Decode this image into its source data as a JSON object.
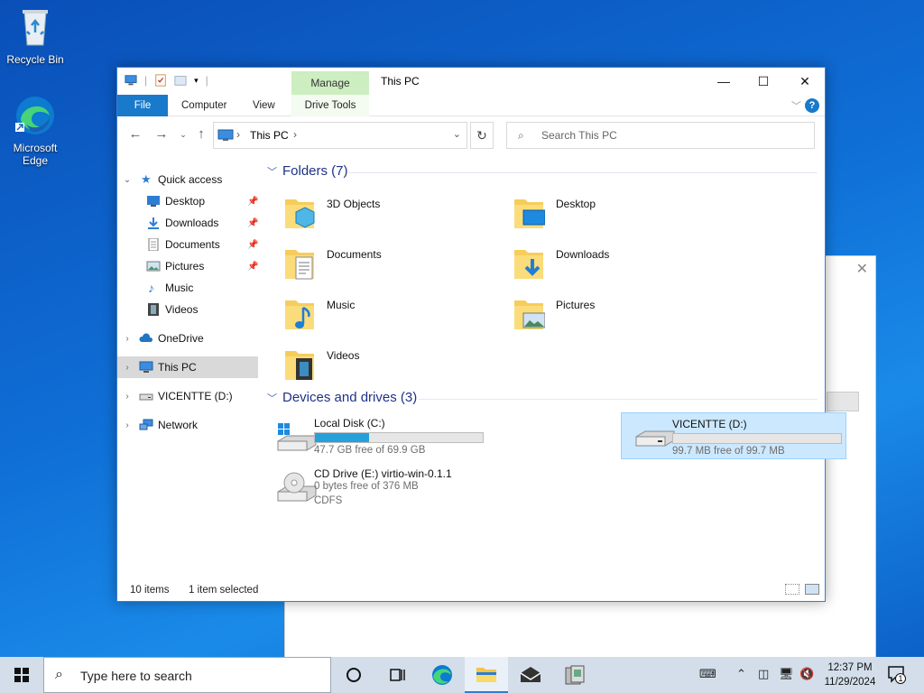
{
  "desktop": {
    "icons": [
      {
        "label": "Recycle Bin"
      },
      {
        "label": "Microsoft Edge"
      }
    ]
  },
  "window": {
    "title": "This PC",
    "manage_tab": "Manage",
    "controls": {
      "minimize": "—",
      "maximize": "☐",
      "close": "✕"
    },
    "ribbon_tabs": {
      "file": "File",
      "computer": "Computer",
      "view": "View",
      "drive_tools": "Drive Tools"
    },
    "help": "?"
  },
  "address_bar": {
    "crumb": "This PC",
    "search_placeholder": "Search This PC"
  },
  "nav_pane": {
    "quick_access": "Quick access",
    "quick_items": [
      {
        "label": "Desktop",
        "pinned": true
      },
      {
        "label": "Downloads",
        "pinned": true
      },
      {
        "label": "Documents",
        "pinned": true
      },
      {
        "label": "Pictures",
        "pinned": true
      },
      {
        "label": "Music",
        "pinned": false
      },
      {
        "label": "Videos",
        "pinned": false
      }
    ],
    "onedrive": "OneDrive",
    "this_pc": "This PC",
    "drive_d": "VICENTTE (D:)",
    "network": "Network"
  },
  "content": {
    "folders_header": "Folders (7)",
    "folders": [
      {
        "name": "3D Objects"
      },
      {
        "name": "Desktop"
      },
      {
        "name": "Documents"
      },
      {
        "name": "Downloads"
      },
      {
        "name": "Music"
      },
      {
        "name": "Pictures"
      },
      {
        "name": "Videos"
      }
    ],
    "drives_header": "Devices and drives (3)",
    "drives": [
      {
        "name": "Local Disk (C:)",
        "free": "47.7 GB free of 69.9 GB",
        "used_fraction": 0.32,
        "selected": false
      },
      {
        "name": "VICENTTE (D:)",
        "free": "99.7 MB free of 99.7 MB",
        "used_fraction": 0.0,
        "selected": true
      },
      {
        "name": "CD Drive (E:) virtio-win-0.1.1",
        "free": "0 bytes free of 376 MB",
        "fs": "CDFS",
        "selected": false
      }
    ]
  },
  "status_bar": {
    "items": "10 items",
    "selection": "1 item selected"
  },
  "taskbar": {
    "search_placeholder": "Type here to search",
    "time": "12:37 PM",
    "date": "11/29/2024",
    "notifications": "1"
  },
  "colors": {
    "accent": "#1979ca",
    "selection": "#cce8ff",
    "drive_bar": "#26a0da",
    "manage_tab": "#cdeec0",
    "header_text": "#1e3287"
  }
}
